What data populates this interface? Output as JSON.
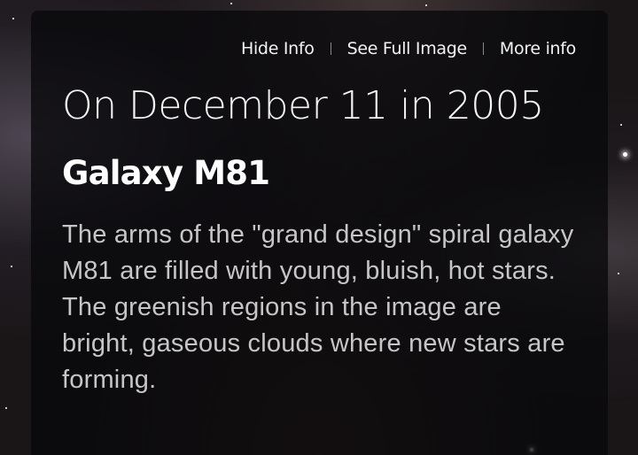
{
  "nav": {
    "hide_info": "Hide Info",
    "see_full_image": "See Full Image",
    "more_info": "More info"
  },
  "date_heading": "On December 11 in 2005",
  "title": "Galaxy M81",
  "description": "The arms of the \"grand design\" spiral galaxy M81 are filled with young, bluish, hot stars. The greenish regions in the image are bright, gaseous clouds where new stars are forming.",
  "colors": {
    "panel": "#08080a",
    "text": "#f4f4f4",
    "description_text": "#c6c6c6"
  }
}
